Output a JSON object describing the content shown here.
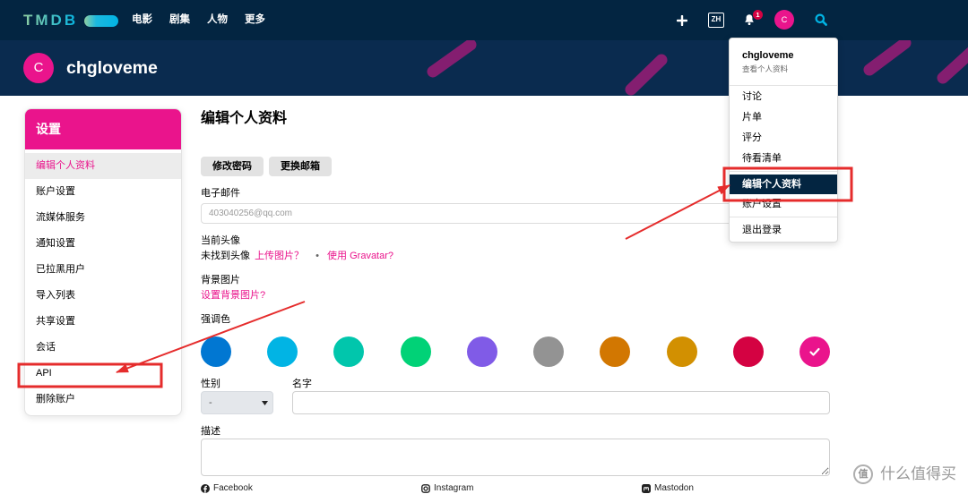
{
  "nav": {
    "logo_text": "TMDB",
    "links": [
      {
        "label": "电影"
      },
      {
        "label": "剧集"
      },
      {
        "label": "人物"
      },
      {
        "label": "更多"
      }
    ],
    "icons": {
      "add": "plus-icon",
      "notifications": "bell-icon",
      "search": "search-icon"
    },
    "language": "ZH",
    "notification_count": "1",
    "avatar_initial": "C"
  },
  "banner": {
    "avatar_initial": "C",
    "username": "chgloveme"
  },
  "sidebar": {
    "title": "设置",
    "items": [
      {
        "label": "编辑个人资料",
        "active": true
      },
      {
        "label": "账户设置"
      },
      {
        "label": "流媒体服务"
      },
      {
        "label": "通知设置"
      },
      {
        "label": "已拉黑用户"
      },
      {
        "label": "导入列表"
      },
      {
        "label": "共享设置"
      },
      {
        "label": "会话"
      },
      {
        "label": "API"
      },
      {
        "label": "删除账户"
      }
    ]
  },
  "main": {
    "title": "编辑个人资料",
    "change_password_label": "修改密码",
    "change_email_label": "更换邮箱",
    "email": {
      "label": "电子邮件",
      "value": "403040256@qq.com"
    },
    "avatar": {
      "label": "当前头像",
      "status": "未找到头像",
      "upload_link": "上传图片？",
      "separator": "•",
      "gravatar_link": "使用 Gravatar?"
    },
    "background": {
      "label": "背景图片",
      "link": "设置背景图片?"
    },
    "accent": {
      "label": "强调色",
      "selected_index": 9,
      "colors": [
        "#0177d2",
        "#01b4e4",
        "#01c6ac",
        "#01d277",
        "#805be7",
        "#939393",
        "#d27701",
        "#d29001",
        "#d40242",
        "#ea148c"
      ]
    },
    "gender": {
      "label": "性别",
      "value": "-"
    },
    "name": {
      "label": "名字"
    },
    "description": {
      "label": "描述"
    },
    "social": [
      {
        "label": "Facebook",
        "icon": "facebook-icon"
      },
      {
        "label": "Instagram",
        "icon": "instagram-icon"
      },
      {
        "label": "Mastodon",
        "icon": "mastodon-icon"
      }
    ]
  },
  "user_menu": {
    "username": "chgloveme",
    "view_profile": "查看个人资料",
    "group_1": [
      {
        "label": "讨论"
      },
      {
        "label": "片单"
      },
      {
        "label": "评分"
      },
      {
        "label": "待看清单"
      }
    ],
    "group_2": [
      {
        "label": "编辑个人资料",
        "active": true
      },
      {
        "label": "账户设置"
      }
    ],
    "logout": "退出登录"
  },
  "watermark": {
    "mark": "值",
    "text": "什么值得买"
  },
  "colors": {
    "nav_bg": "#032541",
    "banner_bg": "#0a2b4f",
    "brand_pink": "#ea148c",
    "brand_blue": "#01b4e4",
    "annotation_red": "#e52c2c"
  }
}
